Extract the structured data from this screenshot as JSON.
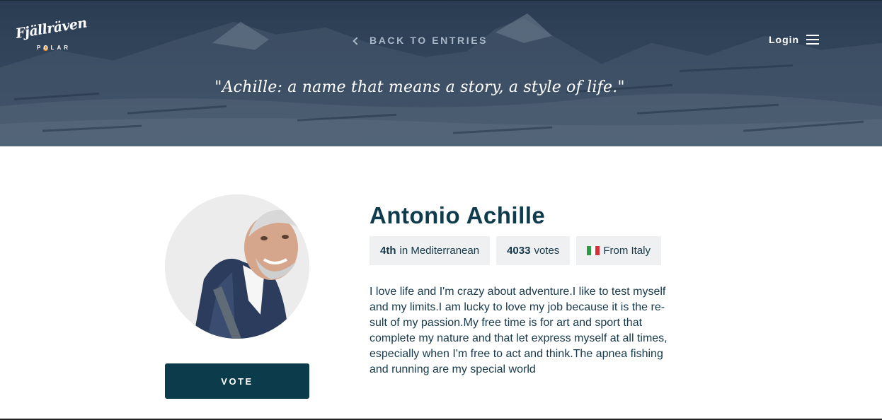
{
  "header": {
    "brand": {
      "name": "Fjällräven",
      "subtitle": "POLAR"
    },
    "back_link": {
      "icon": "chevron-left-icon",
      "label": "BACK TO ENTRIES"
    },
    "login_label": "Login",
    "menu_icon": "hamburger-menu-icon",
    "quote": "\"Achille: a name that means a story, a style of life.\""
  },
  "profile": {
    "name": "Antonio Achille",
    "avatar_alt": "Antonio Achille",
    "vote_label": "VOTE",
    "stats": {
      "rank": "4th",
      "rank_suffix": "in Mediterranean",
      "votes": "4033",
      "votes_suffix": "votes",
      "origin": "From Italy"
    },
    "bio": "I love life and I'm crazy about adventure.I like to test myself and my limits.I am lucky to love my job because it is the re-sult of my passion.My free time is for art and sport that complete my nature and that let express myself at all times, especially when I'm free to act and think.The apnea fishing and running are my special world"
  },
  "colors": {
    "brand_dark": "#0c3b4b",
    "text": "#17394a",
    "badge_bg": "#eef0f1",
    "accent_orange": "#e8902e",
    "flag": [
      "#2f9a45",
      "#ffffff",
      "#d9313a"
    ]
  }
}
